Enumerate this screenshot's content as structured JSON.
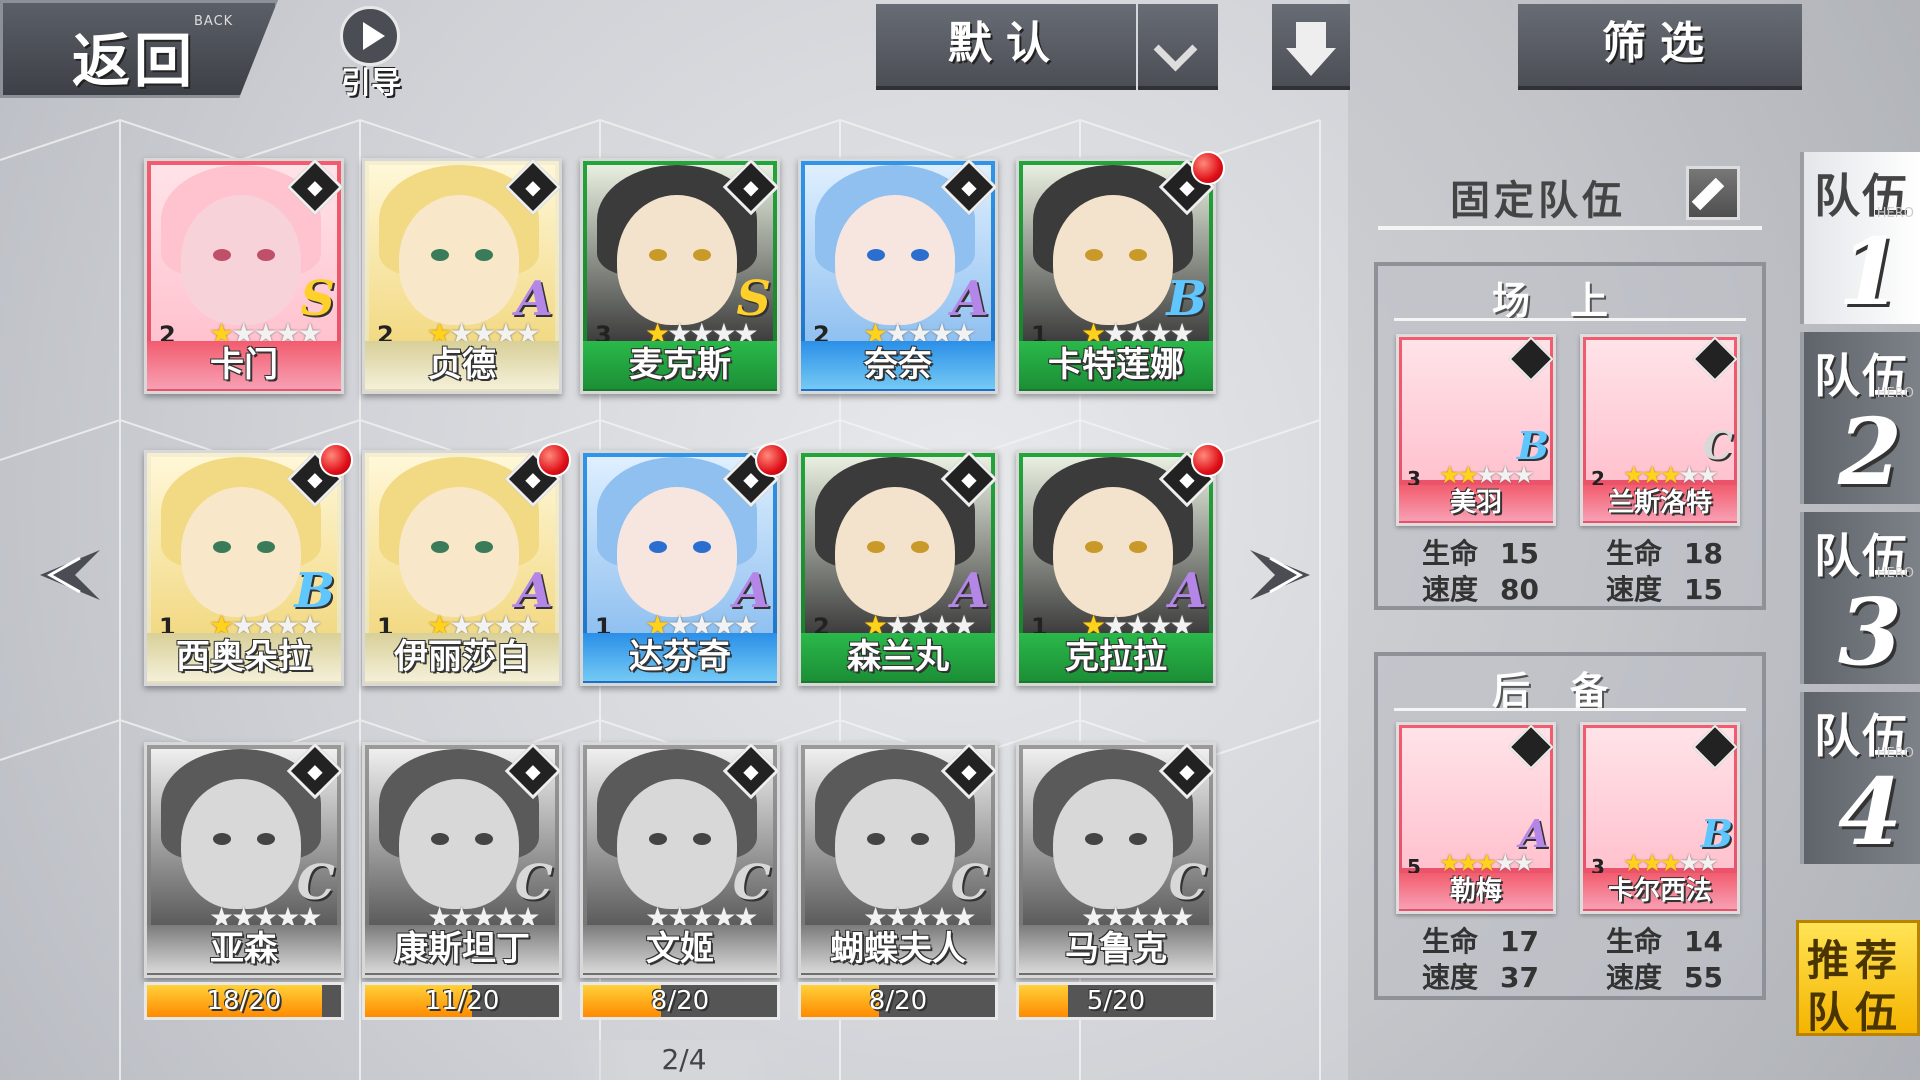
{
  "topbar": {
    "back_label": "返回",
    "back_sub": "BACK",
    "guide_label": "引导",
    "sort_label": "默认",
    "filter_label": "筛选"
  },
  "heroes": [
    {
      "name": "卡门",
      "level": "2",
      "stars": 1,
      "rank": "S",
      "color": "red",
      "class_icon": "mask-icon",
      "badge": false
    },
    {
      "name": "贞德",
      "level": "2",
      "stars": 1,
      "rank": "A",
      "color": "gold",
      "class_icon": "shield-icon",
      "badge": false
    },
    {
      "name": "麦克斯",
      "level": "3",
      "stars": 1,
      "rank": "S",
      "color": "green",
      "class_icon": "diamond-icon",
      "badge": false
    },
    {
      "name": "奈奈",
      "level": "2",
      "stars": 1,
      "rank": "A",
      "color": "blue",
      "class_icon": "hat-icon",
      "badge": false
    },
    {
      "name": "卡特莲娜",
      "level": "1",
      "stars": 1,
      "rank": "B",
      "color": "green",
      "class_icon": "hat-icon",
      "badge": true
    },
    {
      "name": "西奥朵拉",
      "level": "1",
      "stars": 1,
      "rank": "B",
      "color": "gold",
      "class_icon": "hat-icon",
      "badge": true
    },
    {
      "name": "伊丽莎白",
      "level": "1",
      "stars": 1,
      "rank": "A",
      "color": "gold",
      "class_icon": "sword-icon",
      "badge": true
    },
    {
      "name": "达芬奇",
      "level": "1",
      "stars": 1,
      "rank": "A",
      "color": "blue",
      "class_icon": "flask-icon",
      "badge": true
    },
    {
      "name": "森兰丸",
      "level": "2",
      "stars": 1,
      "rank": "A",
      "color": "green",
      "class_icon": "fist-icon",
      "badge": false
    },
    {
      "name": "克拉拉",
      "level": "1",
      "stars": 1,
      "rank": "A",
      "color": "green",
      "class_icon": "cup-icon",
      "badge": true
    }
  ],
  "locked_heroes": [
    {
      "name": "亚森",
      "stars": 0,
      "rank": "C",
      "class_icon": "shuriken-icon",
      "shards": "18/20",
      "progress": 0.9
    },
    {
      "name": "康斯坦丁",
      "stars": 0,
      "rank": "C",
      "class_icon": "fist-icon",
      "shards": "11/20",
      "progress": 0.55
    },
    {
      "name": "文姬",
      "stars": 0,
      "rank": "C",
      "class_icon": "flag-icon",
      "shards": "8/20",
      "progress": 0.4
    },
    {
      "name": "蝴蝶夫人",
      "stars": 0,
      "rank": "C",
      "class_icon": "flag-icon",
      "shards": "8/20",
      "progress": 0.4
    },
    {
      "name": "马鲁克",
      "stars": 0,
      "rank": "C",
      "class_icon": "lightning-icon",
      "shards": "5/20",
      "progress": 0.25
    }
  ],
  "pagination": "2/4",
  "team_panel": {
    "title": "固定队伍",
    "onfield_label": "场上",
    "reserve_label": "后备",
    "stat_hp": "生命",
    "stat_spd": "速度",
    "onfield": [
      {
        "name": "美羽",
        "level": "3",
        "stars": 2,
        "rank": "B",
        "hp": "15",
        "spd": "80",
        "color": "red"
      },
      {
        "name": "兰斯洛特",
        "level": "2",
        "stars": 3,
        "rank": "C",
        "hp": "18",
        "spd": "15",
        "color": "red"
      }
    ],
    "reserve": [
      {
        "name": "勒梅",
        "level": "5",
        "stars": 3,
        "rank": "A",
        "hp": "17",
        "spd": "37",
        "color": "red"
      },
      {
        "name": "卡尔西法",
        "level": "3",
        "stars": 3,
        "rank": "B",
        "hp": "14",
        "spd": "55",
        "color": "red"
      }
    ]
  },
  "team_tabs": [
    {
      "label": "队伍",
      "hero": "HERO",
      "num": "1"
    },
    {
      "label": "队伍",
      "hero": "HERO",
      "num": "2"
    },
    {
      "label": "队伍",
      "hero": "HERO",
      "num": "3"
    },
    {
      "label": "队伍",
      "hero": "HERO",
      "num": "4"
    }
  ],
  "recommend": {
    "line1": "推荐",
    "line2": "队伍"
  },
  "colors": {
    "red": "#e9506a",
    "gold": "#e9e1b5",
    "green": "#1c8f36",
    "blue": "#1b6fc4",
    "gray": "#7c7c7c",
    "accent": "#f5b400"
  }
}
